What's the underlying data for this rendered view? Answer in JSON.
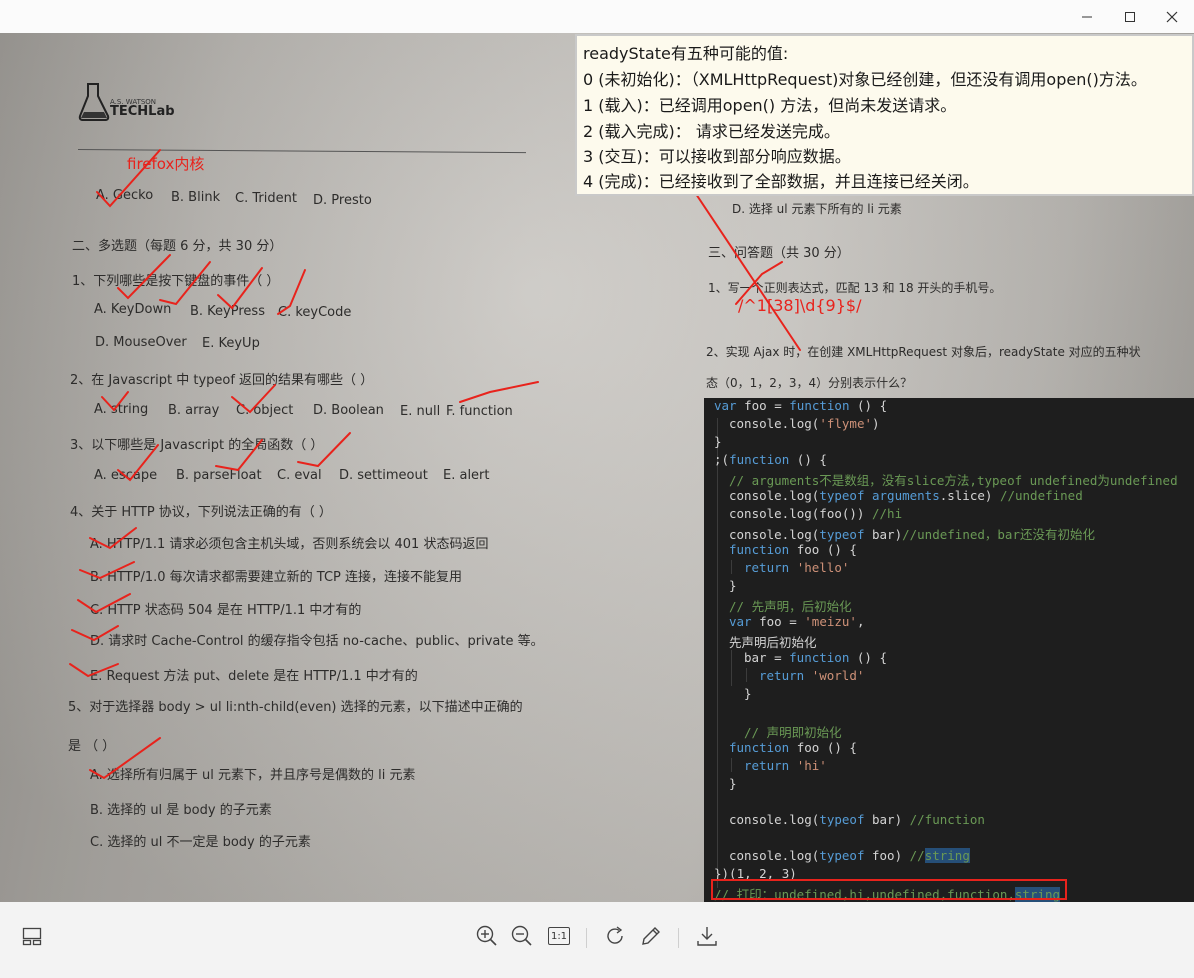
{
  "window": {
    "buttons": {
      "minimize_icon": "minimize-icon",
      "maximize_icon": "maximize-icon",
      "close_icon": "close-icon"
    }
  },
  "photo": {
    "logo": {
      "brand_small": "A.S. WATSON",
      "brand": "TECHLab"
    },
    "lines": [
      "A. Gecko",
      "B. Blink",
      "C. Trident",
      "D. Presto",
      "二、多选题（每题 6 分，共 30 分）",
      "1、下列哪些是按下键盘的事件（ ）",
      "A. KeyDown",
      "B. KeyPress",
      "C. keyCode",
      "D. MouseOver",
      "E. KeyUp",
      "2、在 Javascript 中 typeof 返回的结果有哪些（ ）",
      "A. string",
      "B. array",
      "C. object",
      "D. Boolean",
      "E. null",
      "F. function",
      "3、以下哪些是 Javascript 的全局函数（ ）",
      "A. escape",
      "B. parseFloat",
      "C. eval",
      "D. settimeout",
      "E. alert",
      "4、关于 HTTP 协议，下列说法正确的有（ ）",
      "A. HTTP/1.1 请求必须包含主机头域，否则系统会以 401 状态码返回",
      "B. HTTP/1.0 每次请求都需要建立新的 TCP 连接，连接不能复用",
      "C. HTTP 状态码 504 是在 HTTP/1.1 中才有的",
      "D. 请求时 Cache-Control 的缓存指令包括 no-cache、public、private 等。",
      "E. Request 方法 put、delete 是在 HTTP/1.1 中才有的",
      "5、对于选择器 body > ul li:nth-child(even) 选择的元素，以下描述中正确的",
      "是 （ ）",
      "A. 选择所有归属于 ul 元素下，并且序号是偶数的 li 元素",
      "B. 选择的 ul 是 body 的子元素",
      "C. 选择的 ul 不一定是 body 的子元素",
      "D. 选择 ul 元素下所有的 li 元素",
      "三、问答题（共 30 分）",
      "1、写一个正则表达式，匹配 13 和 18 开头的手机号。",
      "2、实现 Ajax 时，在创建 XMLHttpRequest 对象后，readyState 对应的五种状",
      "态（0，1，2，3，4）分别表示什么？"
    ],
    "annotations": {
      "firefox": "firefox内核",
      "regex": "/^1[38]\\d{9}$/",
      "accent_color": "#e8231c"
    }
  },
  "note": {
    "lines": [
      "readyState有五种可能的值:",
      "0 (未初始化)：（XMLHttpRequest)对象已经创建，但还没有调用open()方法。",
      "1 (载入)：已经调用open() 方法，但尚未发送请求。",
      "2 (载入完成)： 请求已经发送完成。",
      "3 (交互)：可以接收到部分响应数据。",
      "4 (完成)：已经接收到了全部数据，并且连接已经关闭。"
    ]
  },
  "code": {
    "lines": [
      "var foo = function () {",
      "console.log('flyme')",
      "}",
      ";(function () {",
      "// arguments不是数组，没有slice方法,typeof undefined为undefined",
      "console.log(typeof arguments.slice) //undefined",
      "console.log(foo()) //hi",
      "console.log(typeof bar)//undefined，bar还没有初始化",
      "function foo () {",
      "return 'hello'",
      "}",
      "// 先声明，后初始化",
      "var foo = 'meizu',",
      "先声明后初始化",
      "bar = function () {",
      "return 'world'",
      "}",
      "// 声明即初始化",
      "function foo () {",
      "return 'hi'",
      "}",
      "console.log(typeof bar) //function",
      "console.log(typeof foo) //string",
      "})(1, 2, 3)",
      "// 打印：undefined,hi,undefined,function,string"
    ]
  },
  "toolbar": {
    "thumbnails_icon": "thumbnails-icon",
    "zoom_in_icon": "zoom-in-icon",
    "zoom_out_icon": "zoom-out-icon",
    "actual_size_label": "1:1",
    "rotate_icon": "rotate-icon",
    "edit_icon": "pencil-icon",
    "download_icon": "download-icon"
  }
}
